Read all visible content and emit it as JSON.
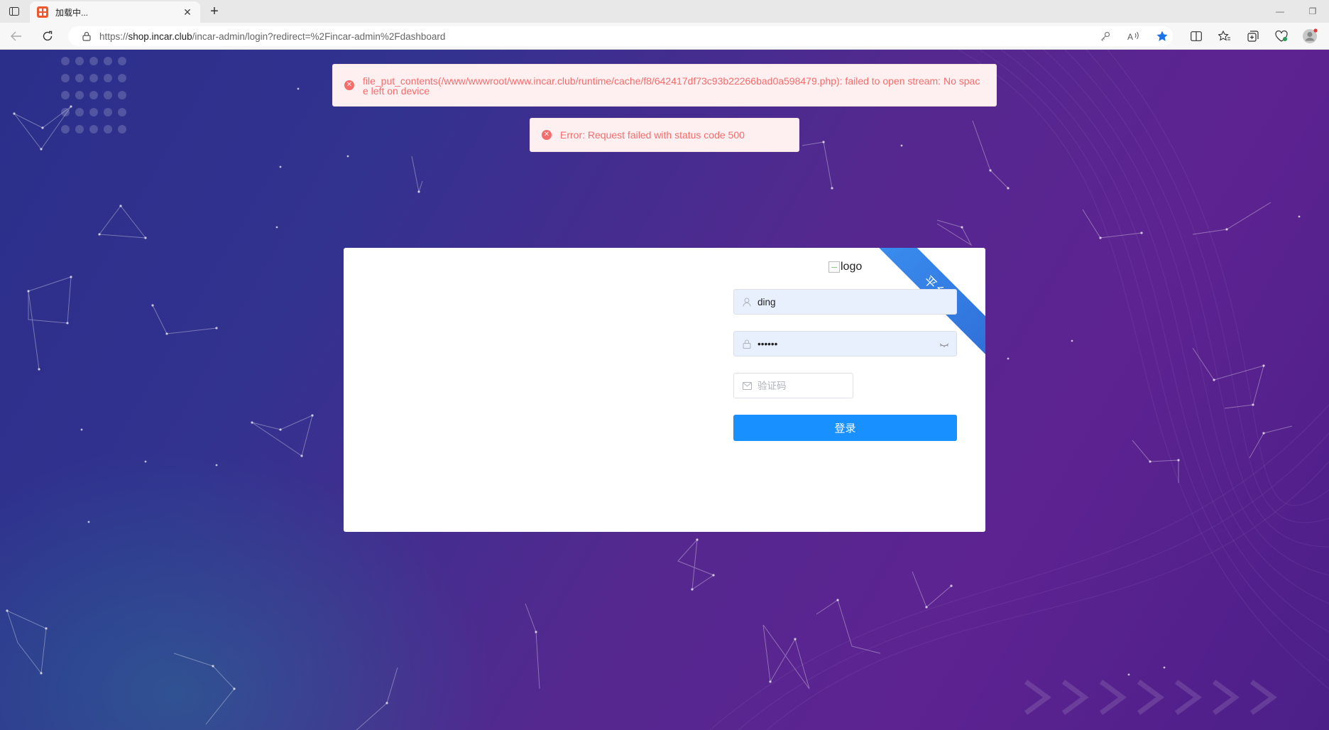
{
  "browser": {
    "tab_title": "加载中...",
    "favicon_text": "盛世\n车品",
    "url_prefix": "https://",
    "url_host": "shop.incar.club",
    "url_path": "/incar-admin/login?redirect=%2Fincar-admin%2Fdashboard"
  },
  "alerts": [
    {
      "text": "file_put_contents(/www/wwwroot/www.incar.club/runtime/cache/f8/642417df73c93b22266bad0a598479.php): failed to open stream: No space left on device"
    },
    {
      "text": "Error: Request failed with status code 500"
    }
  ],
  "login": {
    "ribbon": "平台端",
    "logo_alt": "logo",
    "username_value": "ding",
    "password_value": "••••••",
    "captcha_placeholder": "验证码",
    "submit_label": "登录"
  },
  "colors": {
    "primary": "#1890ff",
    "error": "#f56c6c",
    "ribbon": "#3a8ef0"
  }
}
